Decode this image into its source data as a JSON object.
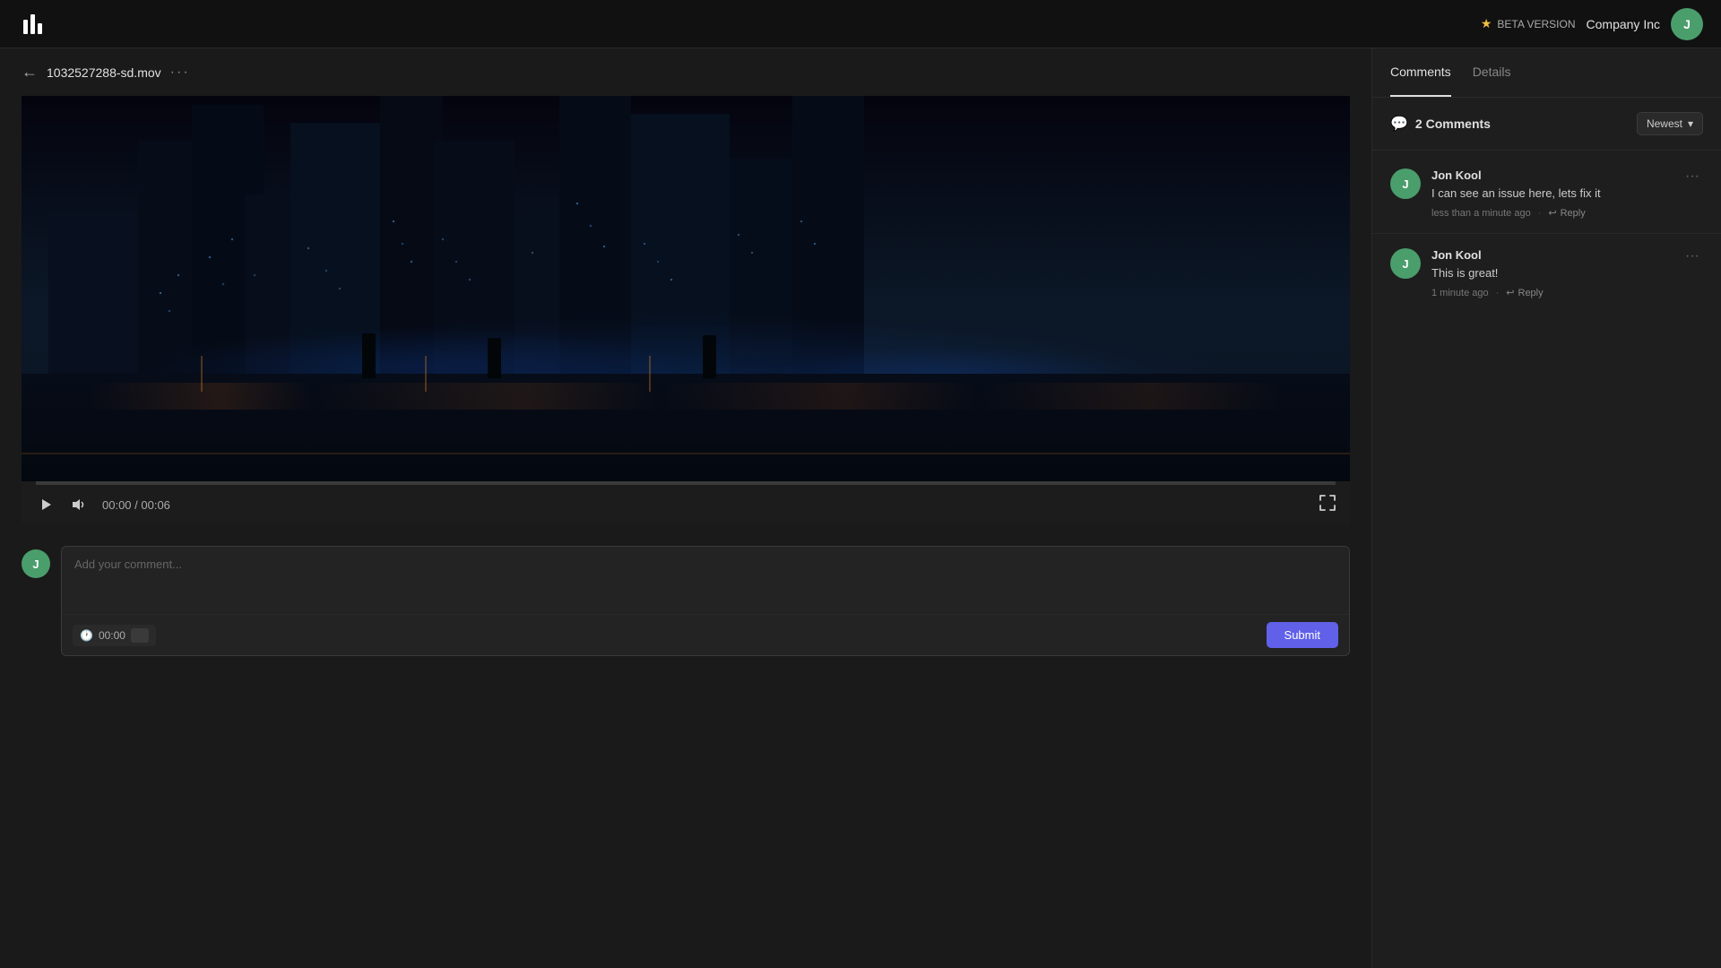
{
  "nav": {
    "beta_label": "BETA VERSION",
    "company_name": "Company Inc",
    "user_initial": "J"
  },
  "file": {
    "name": "1032527288-sd.mov",
    "back_label": "←",
    "menu_label": "···"
  },
  "video": {
    "current_time": "00:00",
    "total_time": "00:06",
    "time_display": "00:00 / 00:06"
  },
  "comment_input": {
    "placeholder": "Add your comment...",
    "timestamp_label": "00:00",
    "submit_label": "Submit",
    "user_initial": "J"
  },
  "sidebar": {
    "tabs": [
      {
        "label": "Comments",
        "active": true
      },
      {
        "label": "Details",
        "active": false
      }
    ],
    "comments_count_label": "2 Comments",
    "sort_label": "Newest",
    "comments": [
      {
        "id": 1,
        "user_name": "Jon Kool",
        "user_initial": "J",
        "text": "I can see an issue here, lets fix it",
        "time": "less than a minute ago",
        "reply_label": "Reply"
      },
      {
        "id": 2,
        "user_name": "Jon Kool",
        "user_initial": "J",
        "text": "This is great!",
        "time": "1 minute ago",
        "reply_label": "Reply"
      }
    ]
  }
}
